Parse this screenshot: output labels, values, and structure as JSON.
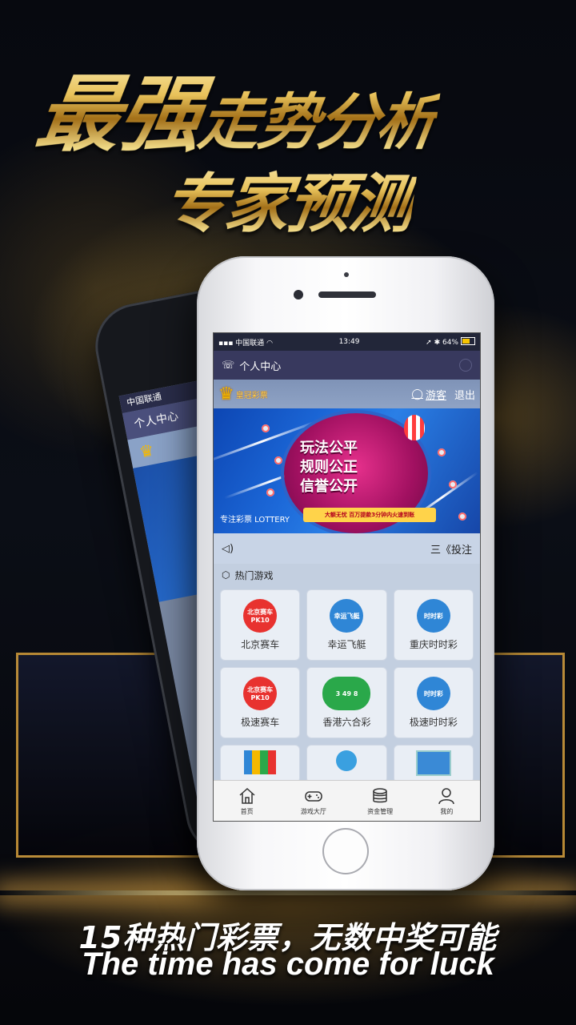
{
  "hero": {
    "line1_big": "最强",
    "line1_rest": "走势分析",
    "line2": "专家预测"
  },
  "back_phone": {
    "status_carrier": "中国联通",
    "title": "个人中心"
  },
  "status_bar": {
    "carrier": "中国联通",
    "time": "13:49",
    "battery": "64%"
  },
  "navbar": {
    "title": "个人中心"
  },
  "userbar": {
    "brand": "皇冠彩票",
    "user_label": "游客",
    "exit_label": "退出"
  },
  "banner": {
    "slogan_line1": "玩法公平",
    "slogan_line2": "规则公正",
    "slogan_line3": "信誉公开",
    "ribbon": "大额无忧 百万提款3分钟内火速到账",
    "tag": "专注彩票 LOTTERY"
  },
  "notice": {
    "text": "三《投注"
  },
  "hot_games": {
    "title": "热门游戏",
    "items": [
      {
        "name": "北京赛车",
        "logo": "北京赛车 PK10",
        "color": "#e8322f"
      },
      {
        "name": "幸运飞艇",
        "logo": "幸运飞艇",
        "color": "#2f86d6"
      },
      {
        "name": "重庆时时彩",
        "logo": "时时彩",
        "color": "#2f86d6"
      },
      {
        "name": "极速赛车",
        "logo": "北京赛车 PK10",
        "color": "#e8322f"
      },
      {
        "name": "香港六合彩",
        "logo": "3 49 8",
        "color": "#2aa84a"
      },
      {
        "name": "极速时时彩",
        "logo": "时时彩",
        "color": "#2f86d6"
      }
    ]
  },
  "tabbar": {
    "home": "首页",
    "games": "游戏大厅",
    "funds": "资金管理",
    "mine": "我的"
  },
  "footer": {
    "cn": "15种热门彩票，无数中奖可能",
    "en": "The time has come for luck"
  }
}
